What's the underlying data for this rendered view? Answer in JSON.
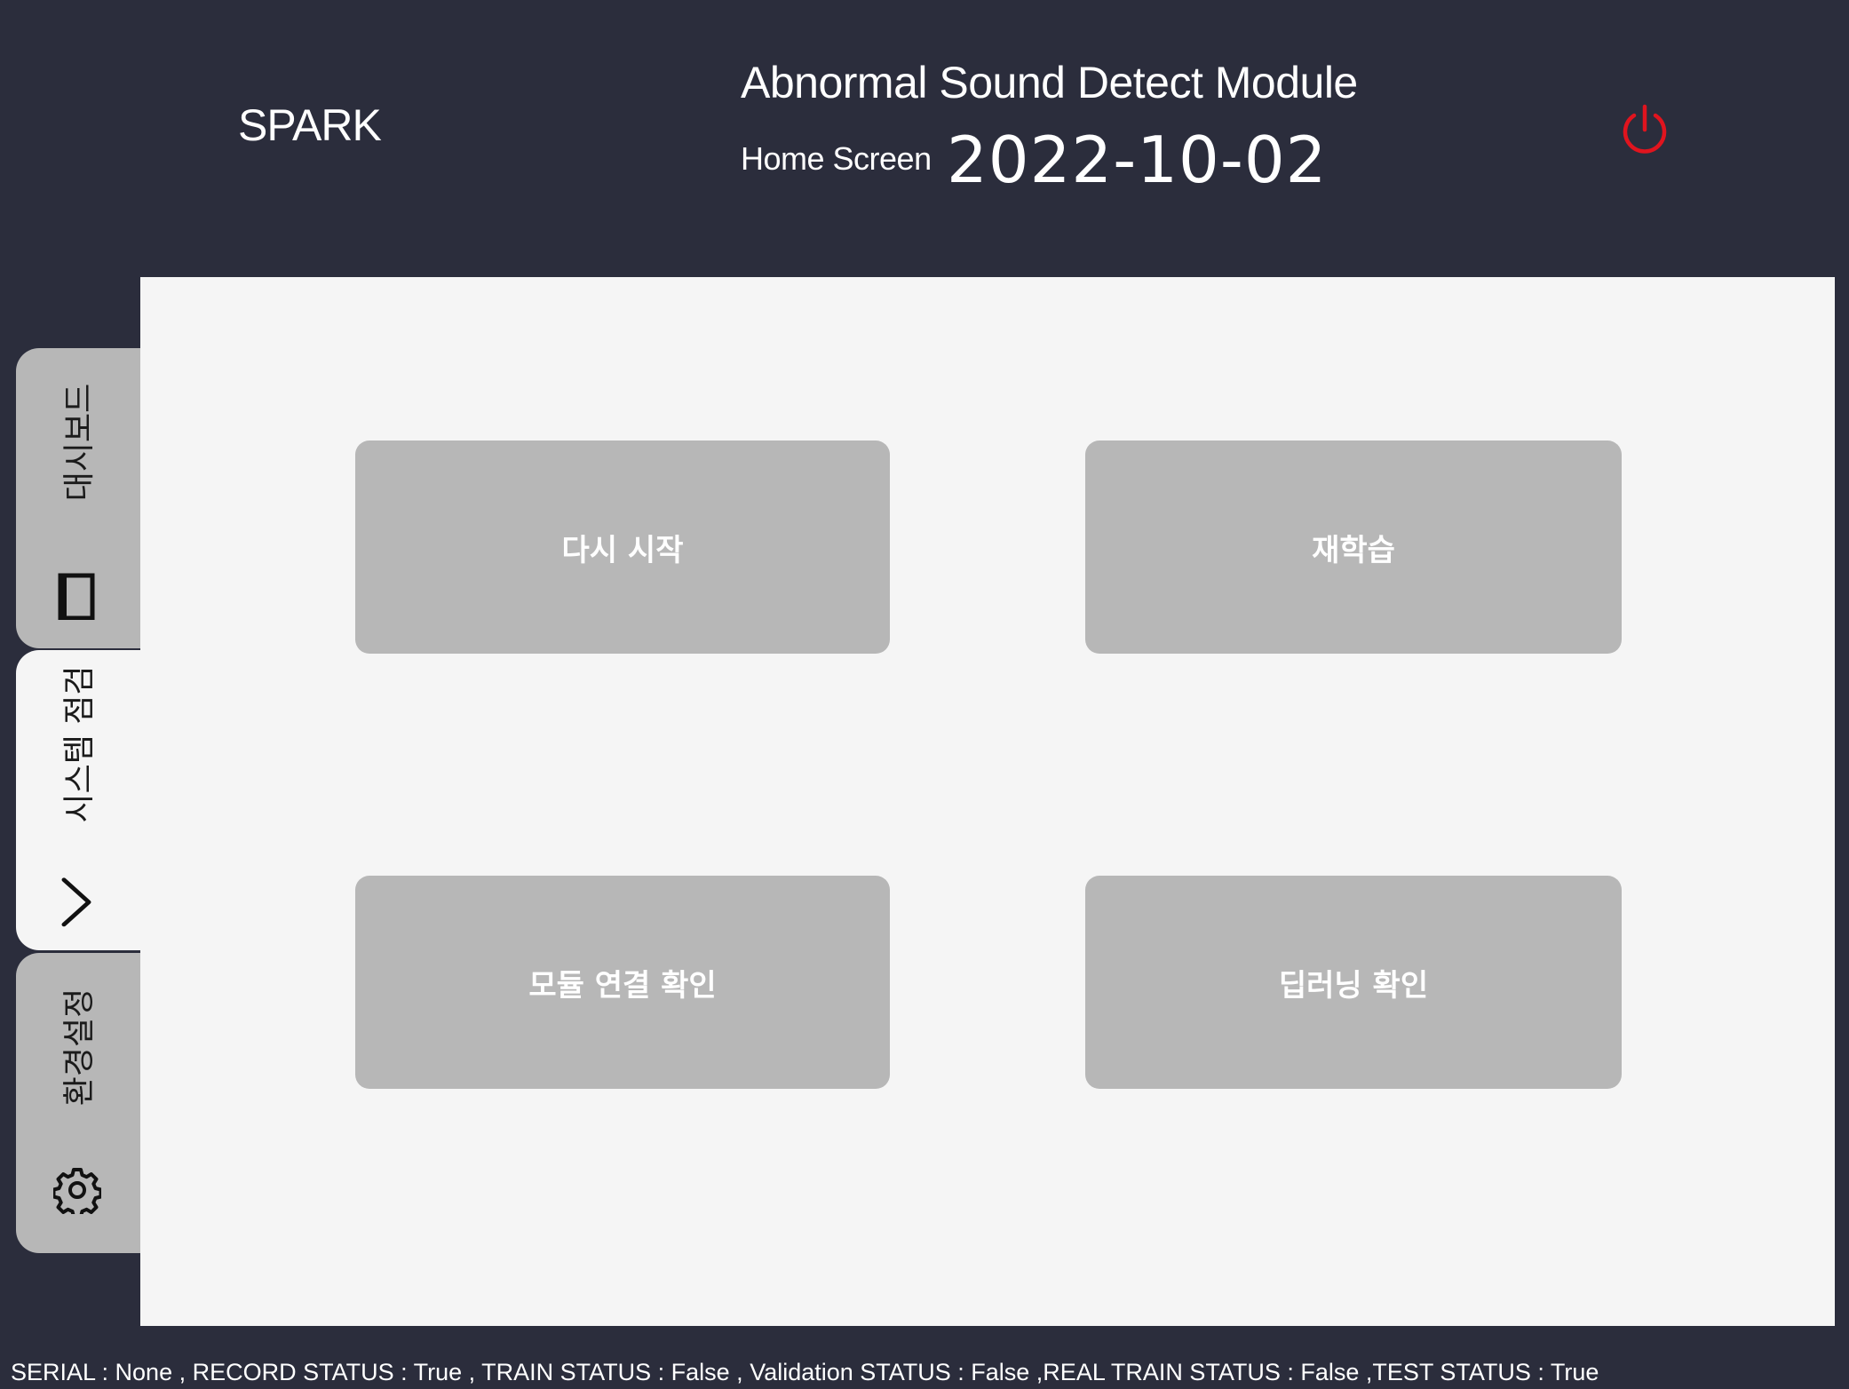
{
  "header": {
    "brand": "SPARK",
    "app_title": "Abnormal Sound Detect Module",
    "screen_title": "Home Screen",
    "date": "2022-10-02",
    "power_icon": "power-icon",
    "power_color": "#e0141e"
  },
  "sidebar": {
    "tabs": [
      {
        "label": "대시보드",
        "icon": "dashboard-window-icon",
        "active": false
      },
      {
        "label": "시스템 점검",
        "icon": "chevron-right-icon",
        "active": true
      },
      {
        "label": "환경설정",
        "icon": "gear-icon",
        "active": false
      }
    ]
  },
  "main": {
    "buttons": [
      {
        "label": "다시 시작"
      },
      {
        "label": "재학습"
      },
      {
        "label": "모듈 연결 확인"
      },
      {
        "label": "딥러닝 확인"
      }
    ]
  },
  "status_bar": {
    "text": "SERIAL : None , RECORD STATUS : True , TRAIN STATUS : False , Validation STATUS : False ,REAL TRAIN STATUS : False ,TEST STATUS : True"
  },
  "colors": {
    "header_bg": "#2b2d3c",
    "content_bg": "#f5f5f5",
    "tile_bg": "#b7b7b7"
  }
}
